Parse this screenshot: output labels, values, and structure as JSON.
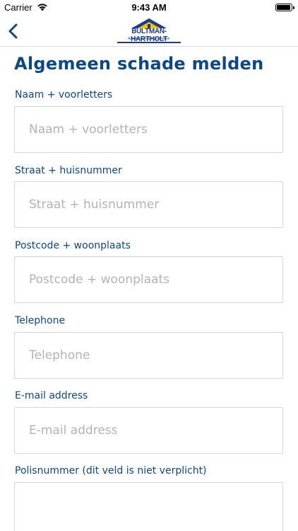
{
  "status": {
    "carrier": "Carrier",
    "time": "9:43 AM"
  },
  "nav": {
    "back_icon": "chevron-left-icon",
    "logo_text": "BULTMAN-HARTHOLT",
    "logo_subtext": "Assurantiën & Hypotheken"
  },
  "page": {
    "title": "Algemeen schade melden"
  },
  "form": {
    "fields": [
      {
        "label": "Naam + voorletters",
        "placeholder": "Naam + voorletters",
        "value": ""
      },
      {
        "label": "Straat + huisnummer",
        "placeholder": "Straat + huisnummer",
        "value": ""
      },
      {
        "label": "Postcode + woonplaats",
        "placeholder": "Postcode + woonplaats",
        "value": ""
      },
      {
        "label": "Telephone",
        "placeholder": "Telephone",
        "value": ""
      },
      {
        "label": "E-mail address",
        "placeholder": "E-mail address",
        "value": ""
      },
      {
        "label": "Polisnummer (dit veld is niet verplicht)",
        "placeholder": "",
        "value": ""
      }
    ]
  },
  "colors": {
    "accent": "#0c4787",
    "logo_blue": "#1a3d8f",
    "logo_yellow": "#f5c400",
    "border": "#d6d6d6",
    "placeholder": "#b3b3b3"
  }
}
